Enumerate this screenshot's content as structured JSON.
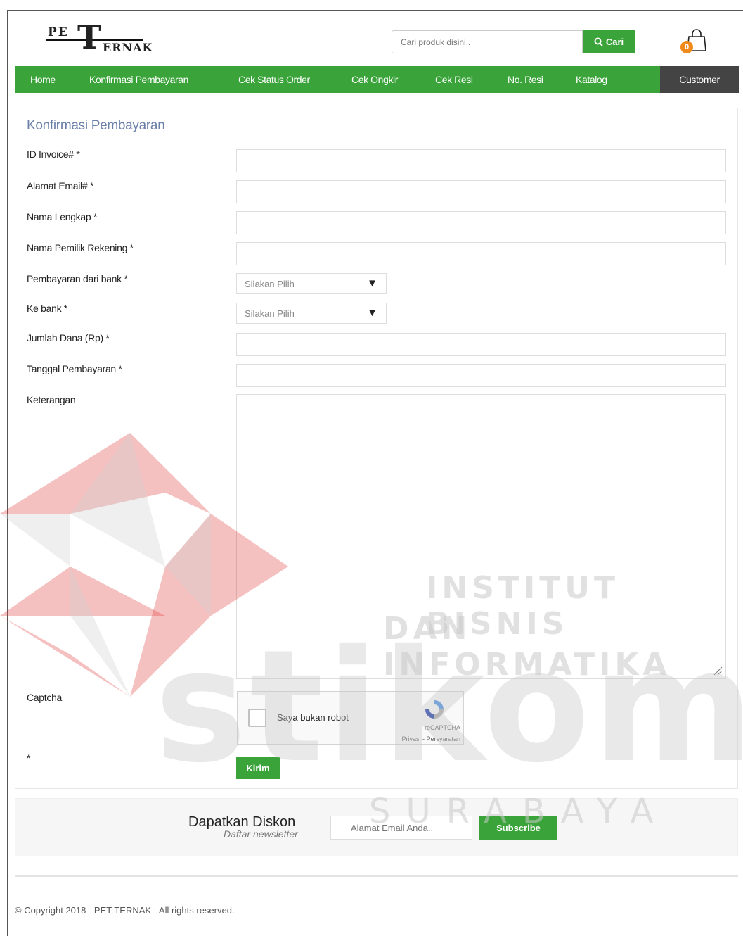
{
  "brand": {
    "logo_pe": "PE",
    "logo_t": "T",
    "logo_rest": "ERNAK"
  },
  "search": {
    "placeholder": "Cari produk disini..",
    "button_label": "Cari"
  },
  "cart": {
    "count": "0"
  },
  "nav": {
    "items": [
      {
        "label": "Home"
      },
      {
        "label": "Konfirmasi Pembayaran"
      },
      {
        "label": "Cek Status Order"
      },
      {
        "label": "Cek Ongkir"
      },
      {
        "label": "Cek Resi"
      },
      {
        "label": "No. Resi"
      },
      {
        "label": "Katalog"
      }
    ],
    "customer": "Customer"
  },
  "form": {
    "title": "Konfirmasi Pembayaran",
    "fields": {
      "invoice": "ID Invoice# *",
      "email": "Alamat Email# *",
      "fullname": "Nama Lengkap *",
      "account_owner": "Nama Pemilik Rekening *",
      "from_bank": "Pembayaran dari bank *",
      "to_bank": "Ke bank *",
      "amount": "Jumlah Dana (Rp) *",
      "date": "Tanggal Pembayaran *",
      "notes": "Keterangan",
      "captcha": "Captcha",
      "dot": "*"
    },
    "select_placeholder": "Silakan Pilih",
    "captcha_text": "Saya bukan robot",
    "captcha_brand": "reCAPTCHA",
    "captcha_terms": "Privasi - Persyaratan",
    "submit": "Kirim"
  },
  "newsletter": {
    "title": "Dapatkan Diskon",
    "subtitle": "Daftar newsletter",
    "placeholder": "Alamat Email Anda..",
    "button": "Subscribe"
  },
  "footer": {
    "copyright": "© Copyright 2018 - PET TERNAK - All rights reserved."
  },
  "watermark": {
    "line1": "INSTITUT BISNIS",
    "line2": "DAN INFORMATIKA",
    "word": "stikom",
    "city": "SURABAYA"
  },
  "colors": {
    "accent": "#3aa33a",
    "nav_dark": "#444444",
    "badge": "#f28a1a",
    "title": "#6a7fa8"
  }
}
